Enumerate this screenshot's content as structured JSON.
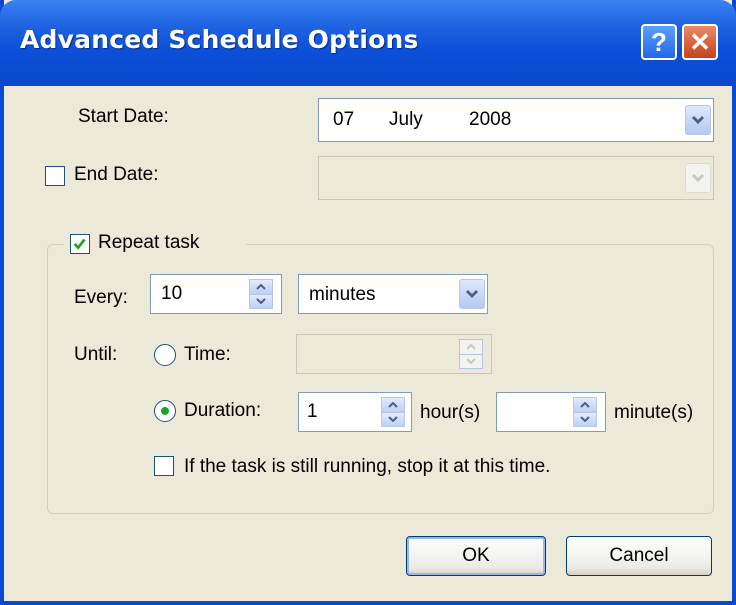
{
  "window": {
    "title": "Advanced Schedule Options",
    "help_glyph": "?",
    "close_glyph": "✕"
  },
  "start_date": {
    "label": "Start Date:",
    "day": "07",
    "month": "July",
    "year": "2008"
  },
  "end_date": {
    "label": "End Date:",
    "checked": false
  },
  "repeat": {
    "label": "Repeat task",
    "checked": true,
    "every_label": "Every:",
    "every_value": "10",
    "unit_value": "minutes",
    "until_label": "Until:",
    "time_label": "Time:",
    "duration_label": "Duration:",
    "hours_value": "1",
    "hours_unit": "hour(s)",
    "minutes_value": "",
    "minutes_unit": "minute(s)",
    "stop_label": "If the task is still running, stop it at this time."
  },
  "buttons": {
    "ok": "OK",
    "cancel": "Cancel"
  },
  "colors": {
    "title_bar": "#0a4ad0",
    "dialog_bg": "#ece9d8",
    "check_mark": "#21a121"
  }
}
